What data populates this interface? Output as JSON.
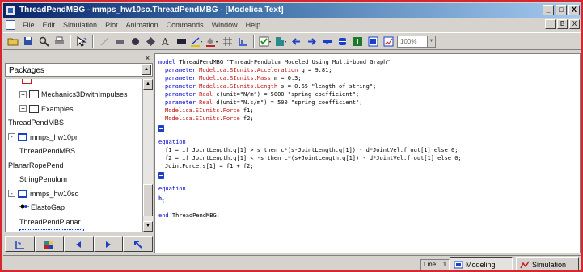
{
  "window": {
    "title": "ThreadPendMBG - mmps_hw10so.ThreadPendMBG - [Modelica Text]",
    "buttons": [
      "_",
      "□",
      "X"
    ],
    "mdi_buttons": [
      "_",
      "B",
      "X"
    ]
  },
  "menu": [
    "File",
    "Edit",
    "Simulation",
    "Plot",
    "Animation",
    "Commands",
    "Window",
    "Help"
  ],
  "toolbar": {
    "zoom": "100%"
  },
  "packages": {
    "header": "Packages",
    "items": [
      {
        "label": "Mechanics3DwithImpulses",
        "indent": 1,
        "expander": "+",
        "box": "plain"
      },
      {
        "label": "Examples",
        "indent": 1,
        "expander": "+",
        "box": "plain"
      },
      {
        "label": "ThreadPendMBS",
        "indent": 0,
        "expander": "",
        "box": "none"
      },
      {
        "label": "mmps_hw10pr",
        "indent": 0,
        "expander": "-",
        "box": "blue"
      },
      {
        "label": "ThreadPendMBS",
        "indent": 1,
        "expander": "",
        "box": "none"
      },
      {
        "label": "PlanarRopePend",
        "indent": 0,
        "expander": "",
        "box": "none"
      },
      {
        "label": "StringPenulum",
        "indent": 1,
        "expander": "",
        "box": "none"
      },
      {
        "label": "mmps_hw10so",
        "indent": 0,
        "expander": "-",
        "box": "blue"
      },
      {
        "label": "ElastoGap",
        "indent": 1,
        "expander": "",
        "box": "none"
      },
      {
        "label": "ThreadPendPlanar",
        "indent": 1,
        "expander": "",
        "box": "none"
      },
      {
        "label": "ThreadPendMBG",
        "indent": 1,
        "expander": "",
        "box": "none",
        "selected": true
      }
    ]
  },
  "code": {
    "model_line": [
      "model",
      " ThreadPendMBG ",
      "\"Thread-Pendulum Modeled Using Multi-bond Graph\""
    ],
    "params": [
      [
        "parameter",
        " Modelica.SIunits.Acceleration",
        " g = 9.81;"
      ],
      [
        "parameter",
        " Modelica.SIunits.Mass",
        " m = 0.3;"
      ],
      [
        "parameter",
        " Modelica.SIunits.Length",
        " s = 0.65 \"length of string\";"
      ],
      [
        "parameter",
        " Real",
        " c(unit=\"N/m\") = 5000 \"spring coefficient\";"
      ],
      [
        "parameter",
        " Real",
        " d(unit=\"N.s/m\") = 500 \"spring coefficient\";"
      ]
    ],
    "decls": [
      [
        "Modelica.SIunits.Force",
        " f1;"
      ],
      [
        "Modelica.SIunits.Force",
        " f2;"
      ]
    ],
    "equation1": "equation",
    "eq_lines": [
      "f1 = if JointLength.q[1] > s then c*(s-JointLength.q[1]) - d*JointVel.f_out[1] else 0;",
      "f2 = if JointLength.q[1] < -s then c*(s+JointLength.q[1]) - d*JointVel.f_out[1] else 0;",
      "JointForce.s[1] = f1 + f2;"
    ],
    "equation2": "equation",
    "end_line": [
      "end",
      " ThreadPendMBG;"
    ]
  },
  "status": {
    "line_label": "Line:",
    "line_value": "1",
    "modeling": "Modeling",
    "simulation": "Simulation"
  }
}
